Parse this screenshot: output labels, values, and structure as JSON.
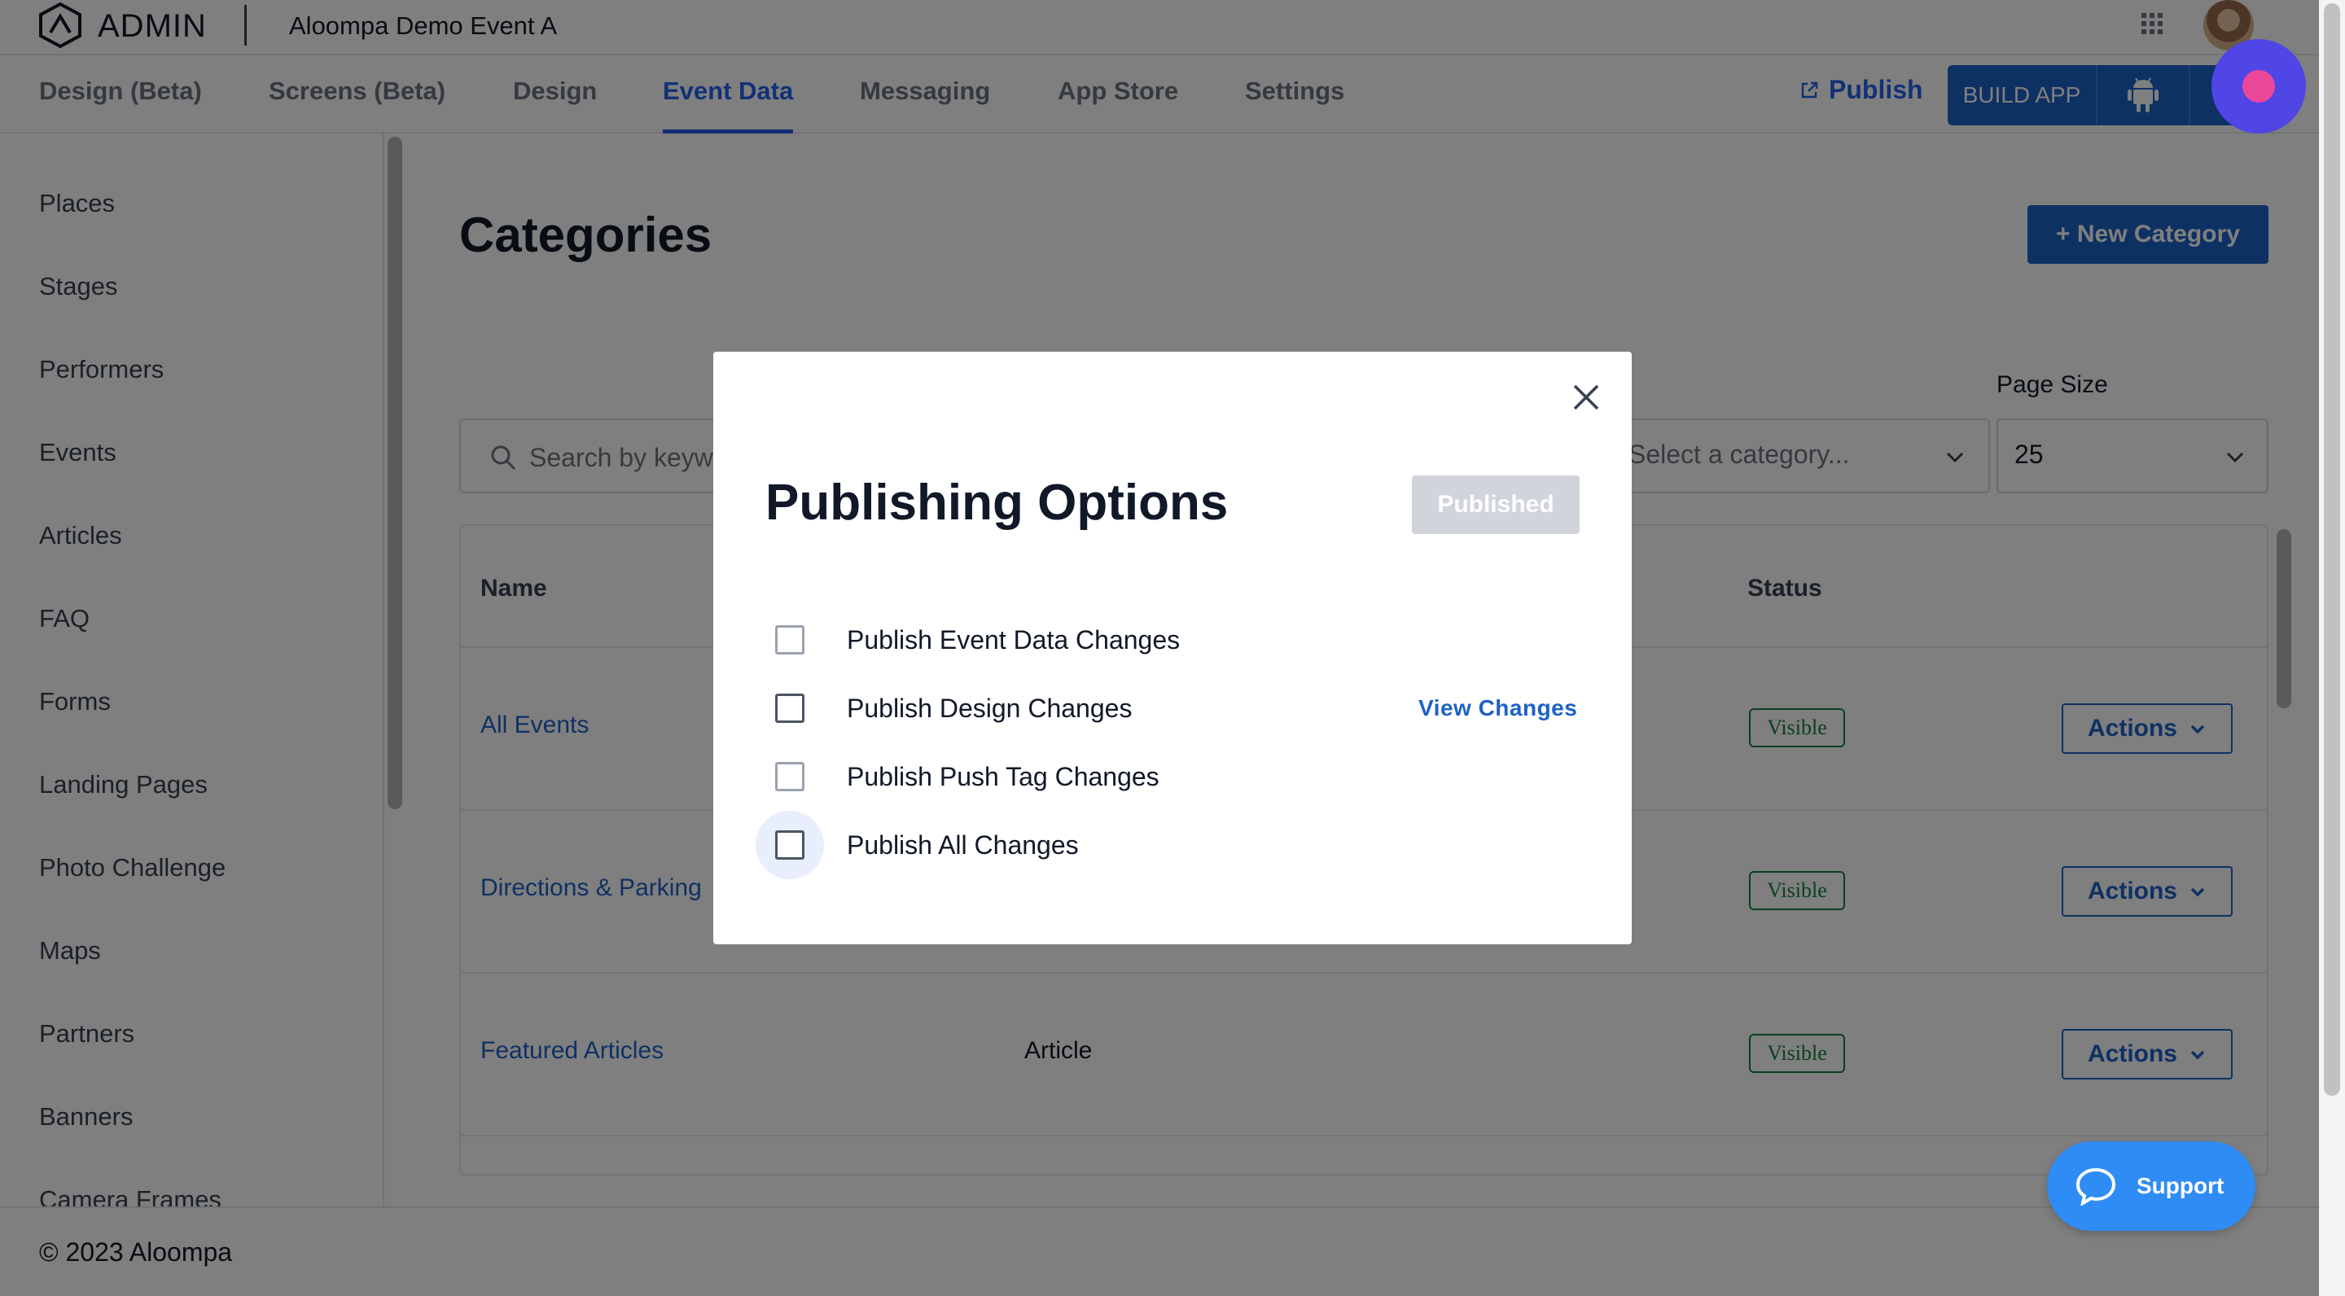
{
  "header": {
    "logo_text": "ADMIN",
    "event_name": "Aloompa Demo Event A"
  },
  "nav": {
    "tabs": [
      {
        "label": "Design (Beta)"
      },
      {
        "label": "Screens (Beta)"
      },
      {
        "label": "Design"
      },
      {
        "label": "Event Data",
        "active": true
      },
      {
        "label": "Messaging"
      },
      {
        "label": "App Store"
      },
      {
        "label": "Settings"
      }
    ],
    "publish_label": "Publish",
    "build_app_label": "BUILD APP"
  },
  "sidebar": {
    "items": [
      {
        "label": "Places"
      },
      {
        "label": "Stages"
      },
      {
        "label": "Performers"
      },
      {
        "label": "Events"
      },
      {
        "label": "Articles"
      },
      {
        "label": "FAQ"
      },
      {
        "label": "Forms"
      },
      {
        "label": "Landing Pages"
      },
      {
        "label": "Photo Challenge"
      },
      {
        "label": "Maps"
      },
      {
        "label": "Partners"
      },
      {
        "label": "Banners"
      },
      {
        "label": "Camera Frames"
      }
    ]
  },
  "main": {
    "title": "Categories",
    "new_button_label": "+ New Category",
    "search_placeholder": "Search by keyword...",
    "category_select_text": "Select a category...",
    "page_size_label": "Page Size",
    "page_size_value": "25",
    "table": {
      "headers": {
        "name": "Name",
        "status": "Status"
      },
      "rows": [
        {
          "name": "All Events",
          "type": "",
          "status": "Visible",
          "actions": "Actions"
        },
        {
          "name": "Directions & Parking",
          "type": "",
          "status": "Visible",
          "actions": "Actions"
        },
        {
          "name": "Featured Articles",
          "type": "Article",
          "status": "Visible",
          "actions": "Actions"
        }
      ]
    }
  },
  "modal": {
    "title": "Publishing Options",
    "status_button": "Published",
    "options": [
      {
        "label": "Publish Event Data Changes",
        "checked": false
      },
      {
        "label": "Publish Design Changes",
        "checked": false
      },
      {
        "label": "Publish Push Tag Changes",
        "checked": false
      },
      {
        "label": "Publish All Changes",
        "checked": false
      }
    ],
    "view_changes_label": "View Changes"
  },
  "footer": {
    "copyright": "© 2023 Aloompa"
  },
  "support": {
    "label": "Support"
  },
  "colors": {
    "accent": "#1d62c7",
    "link": "#2563eb",
    "status_visible": "#15803d",
    "support": "#2f8cf4",
    "record": "#4f46e5"
  }
}
